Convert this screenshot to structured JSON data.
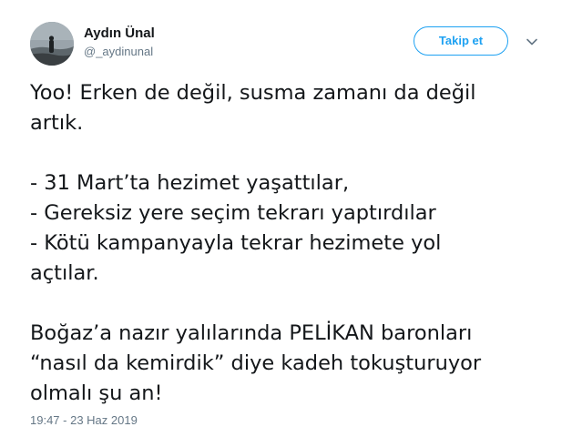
{
  "author": {
    "display_name": "Aydın Ünal",
    "handle": "@_aydinunal"
  },
  "follow_button": {
    "label": "Takip et"
  },
  "icons": {
    "menu": "chevron-down-icon",
    "avatar": "avatar-image"
  },
  "tweet": {
    "lines": [
      "Yoo! Erken de değil, susma zamanı da değil",
      "artık.",
      "",
      "- 31 Mart’ta hezimet yaşattılar,",
      "- Gereksiz yere seçim tekrarı yaptırdılar",
      "- Kötü kampanyayla tekrar hezimete yol",
      "açtılar.",
      "",
      "Boğaz’a nazır yalılarında PELİKAN baronları",
      "“nasıl da kemirdik” diye kadeh tokuşturuyor",
      "olmalı şu an!"
    ],
    "timestamp": "19:47 - 23 Haz 2019"
  },
  "colors": {
    "accent": "#1da1f2",
    "text": "#14171a",
    "secondary": "#657786"
  }
}
